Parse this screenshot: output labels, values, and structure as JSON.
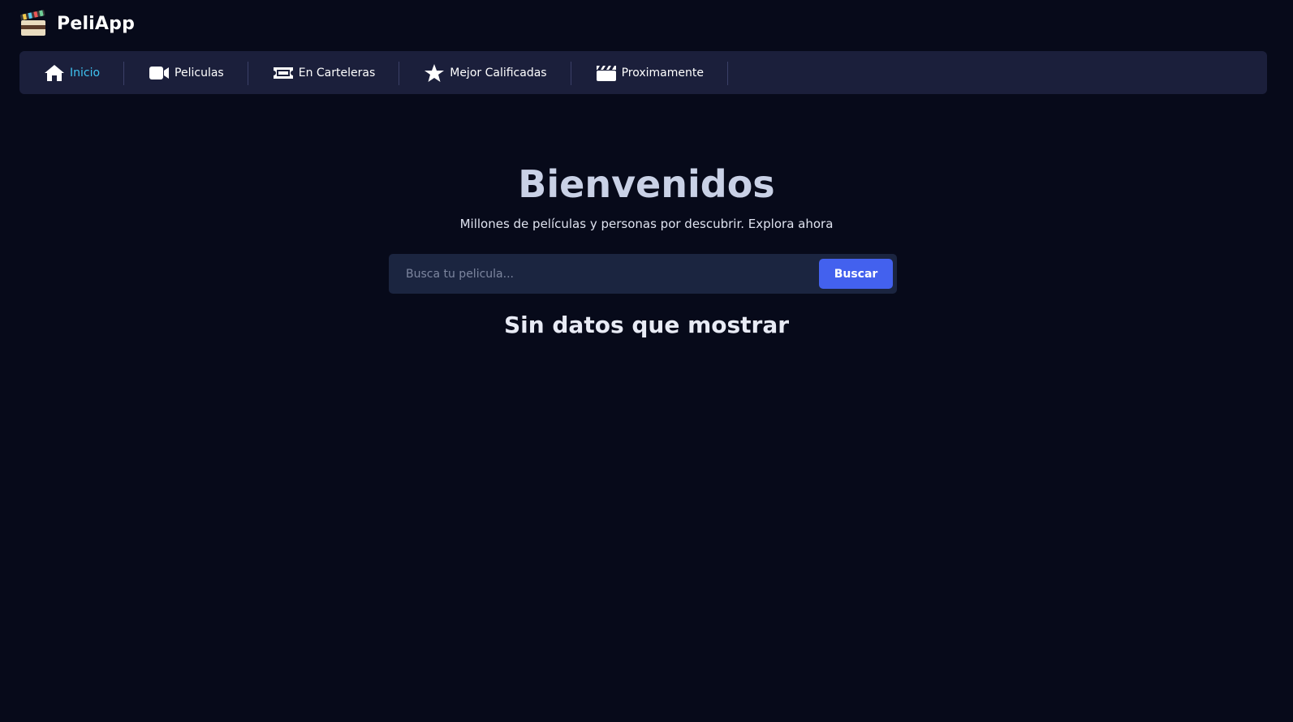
{
  "brand": {
    "name": "PeliApp",
    "logo_icon": "clapperboard-icon"
  },
  "nav": {
    "items": [
      {
        "label": "Inicio",
        "icon": "home-icon",
        "active": true
      },
      {
        "label": "Peliculas",
        "icon": "video-camera-icon",
        "active": false
      },
      {
        "label": "En Carteleras",
        "icon": "ticket-icon",
        "active": false
      },
      {
        "label": "Mejor Calificadas",
        "icon": "star-icon",
        "active": false
      },
      {
        "label": "Proximamente",
        "icon": "clapperboard-icon",
        "active": false
      }
    ]
  },
  "hero": {
    "title": "Bienvenidos",
    "subtitle": "Millones de películas y personas por descubrir. Explora ahora"
  },
  "search": {
    "placeholder": "Busca tu pelicula...",
    "value": "",
    "button_label": "Buscar"
  },
  "results": {
    "empty_message": "Sin datos que mostrar"
  },
  "colors": {
    "background": "#070a1a",
    "navbar": "#1b1f3b",
    "active_nav": "#3fc4f2",
    "button": "#4361ee",
    "search_bg": "#1b2540"
  }
}
